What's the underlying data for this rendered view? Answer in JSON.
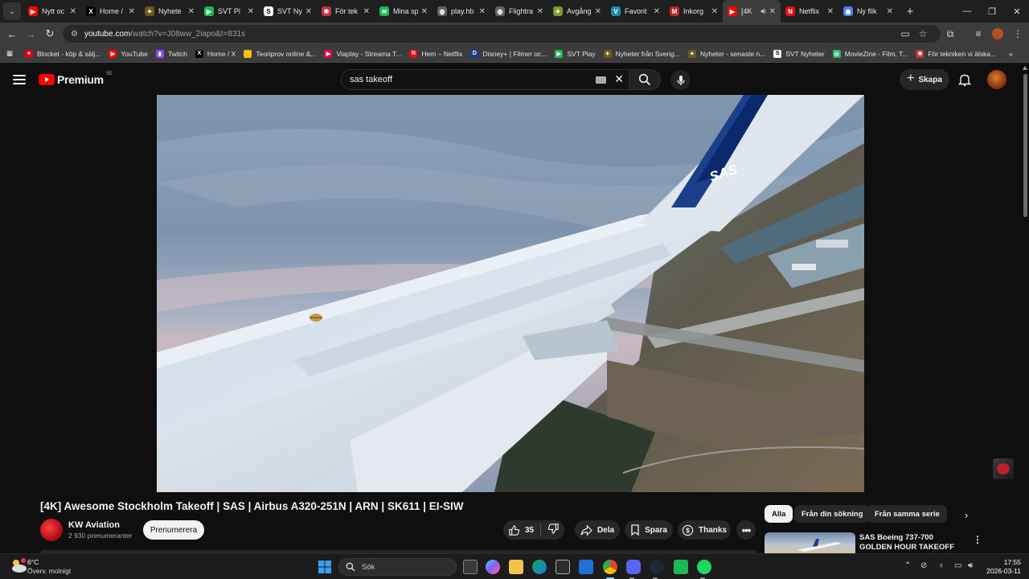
{
  "browser": {
    "tabs": [
      {
        "title": "Nytt oc",
        "icon": "youtube-icon",
        "color": "#ff0000",
        "glyph": "▶",
        "active": false
      },
      {
        "title": "Home /",
        "icon": "x-icon",
        "color": "#000000",
        "glyph": "X",
        "active": false
      },
      {
        "title": "Nyhete",
        "icon": "nyheter-icon",
        "color": "#6b5a1e",
        "glyph": "✦",
        "active": false
      },
      {
        "title": "SVT Pl",
        "icon": "svt-play-icon",
        "color": "#1db954",
        "glyph": "▶",
        "active": false
      },
      {
        "title": "SVT Ny",
        "icon": "svt-nyheter-icon",
        "color": "#ffffff",
        "glyph": "S",
        "active": false
      },
      {
        "title": "För tek",
        "icon": "fortekniken-icon",
        "color": "#c8323c",
        "glyph": "✱",
        "active": false
      },
      {
        "title": "Mina sp",
        "icon": "spotify-icon",
        "color": "#1db954",
        "glyph": "≋",
        "active": false
      },
      {
        "title": "play.hb",
        "icon": "globe-icon",
        "color": "#5f6368",
        "glyph": "◍",
        "active": false
      },
      {
        "title": "Flightra",
        "icon": "globe-icon",
        "color": "#5f6368",
        "glyph": "◍",
        "active": false
      },
      {
        "title": "Avgång",
        "icon": "avgang-icon",
        "color": "#7a9a2a",
        "glyph": "✈",
        "active": false
      },
      {
        "title": "Favorit",
        "icon": "v-icon",
        "color": "#1e8aa6",
        "glyph": "V",
        "active": false
      },
      {
        "title": "Inkorg",
        "icon": "gmail-icon",
        "color": "#c5221f",
        "glyph": "M",
        "active": false
      },
      {
        "title": "[4K",
        "icon": "youtube-icon",
        "color": "#ff0000",
        "glyph": "▶",
        "active": true
      },
      {
        "title": "Netflix",
        "icon": "netflix-icon",
        "color": "#e50914",
        "glyph": "N",
        "active": false
      },
      {
        "title": "Ny flik",
        "icon": "chrome-icon",
        "color": "#4285f4",
        "glyph": "◉",
        "active": false
      }
    ],
    "new_tab": "+",
    "url_domain": "youtube.com",
    "url_rest": "/watch?v=J08ww_2iapo&t=831s",
    "bookmarks": [
      {
        "label": "Blocket - köp & sälj...",
        "icon": "blocket-icon",
        "color": "#e2001a",
        "glyph": "●"
      },
      {
        "label": "YouTube",
        "icon": "youtube-icon",
        "color": "#ff0000",
        "glyph": "▶"
      },
      {
        "label": "Twitch",
        "icon": "twitch-icon",
        "color": "#9146ff",
        "glyph": "▮"
      },
      {
        "label": "Home / X",
        "icon": "x-icon",
        "color": "#000000",
        "glyph": "X"
      },
      {
        "label": "Teoriprov online &...",
        "icon": "teoriprov-icon",
        "color": "#f2c200",
        "glyph": "~"
      },
      {
        "label": "Viaplay - Streama T...",
        "icon": "viaplay-icon",
        "color": "#e4004b",
        "glyph": "▶"
      },
      {
        "label": "Hem – Netflix",
        "icon": "netflix-icon",
        "color": "#e50914",
        "glyph": "N"
      },
      {
        "label": "Disney+ | Filmer oc...",
        "icon": "disney-icon",
        "color": "#1f3c8f",
        "glyph": "D"
      },
      {
        "label": "SVT Play",
        "icon": "svt-play-icon",
        "color": "#1db954",
        "glyph": "▶"
      },
      {
        "label": "Nyheter från Sverig...",
        "icon": "nyheter-icon",
        "color": "#6b5a1e",
        "glyph": "✦"
      },
      {
        "label": "Nyheter - senaste n...",
        "icon": "nyheter-icon",
        "color": "#6b5a1e",
        "glyph": "✦"
      },
      {
        "label": "SVT Nyheter",
        "icon": "svt-nyheter-icon",
        "color": "#ffffff",
        "glyph": "S"
      },
      {
        "label": "MovieZine - Film, T...",
        "icon": "moviezine-icon",
        "color": "#2bb673",
        "glyph": "◎"
      },
      {
        "label": "För tekniken vi älska...",
        "icon": "fortekniken-icon",
        "color": "#c8323c",
        "glyph": "✱"
      }
    ]
  },
  "youtube": {
    "logo_text": "Premium",
    "logo_country": "SE",
    "search_query": "sas takeoff",
    "create_label": "Skapa",
    "video": {
      "title": "[4K] Awesome Stockholm Takeoff | SAS | Airbus A320-251N | ARN | SK611 | EI-SIW",
      "wing_text": "SAS"
    },
    "channel": {
      "name": "KW Aviation",
      "subscribers": "2 930 prenumeranter",
      "subscribe_label": "Prenumerera"
    },
    "actions": {
      "like_count": "35",
      "share_label": "Dela",
      "save_label": "Spara",
      "thanks_label": "Thanks"
    },
    "chips": [
      "Alla",
      "Från din sökning",
      "Från samma serie"
    ],
    "recommendation": {
      "title": "SAS Boeing 737-700 GOLDEN HOUR TAKEOFF from ..."
    }
  },
  "taskbar": {
    "temperature": "6°C",
    "weather": "Överv. molnigt",
    "search_label": "Sök",
    "time": "17:55",
    "date": "2026-03-11"
  }
}
